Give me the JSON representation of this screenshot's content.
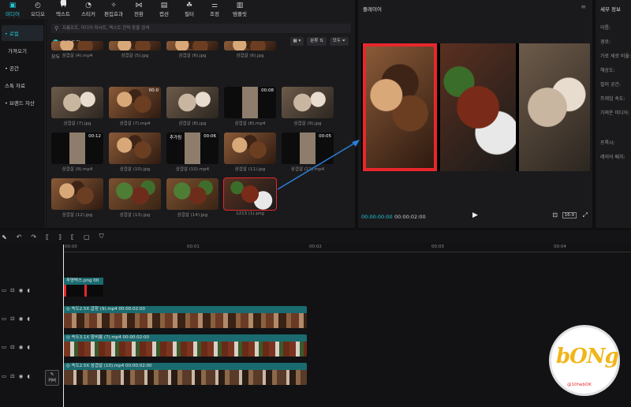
{
  "toolbar": {
    "items": [
      {
        "label": "미디어",
        "icon": "media-icon",
        "active": true
      },
      {
        "label": "오디오",
        "icon": "audio-icon"
      },
      {
        "label": "텍스트",
        "icon": "text-icon"
      },
      {
        "label": "스티커",
        "icon": "sticker-icon"
      },
      {
        "label": "편집효과",
        "icon": "effects-icon"
      },
      {
        "label": "전환",
        "icon": "transition-icon"
      },
      {
        "label": "캡션",
        "icon": "caption-icon"
      },
      {
        "label": "필터",
        "icon": "filter-icon"
      },
      {
        "label": "조정",
        "icon": "adjust-icon"
      },
      {
        "label": "템플릿",
        "icon": "template-icon"
      }
    ]
  },
  "leftnav": {
    "items": [
      {
        "label": "• 로컬",
        "active": true
      },
      {
        "label": "가져오기",
        "sub": true
      },
      {
        "label": "• 공간"
      },
      {
        "label": "스톡 자료"
      },
      {
        "label": "• 브랜드 자산"
      }
    ]
  },
  "media": {
    "search_placeholder": "프롬프트, 미디어 파서트, 텍스트 전략 등을 검색",
    "import_label": "가져오기",
    "sort_label": "분류",
    "all_label": "모두",
    "filter_label": "모두",
    "section_label": "모두",
    "items": [
      {
        "caption": "삼겹살 (4).mp4",
        "style": "meat"
      },
      {
        "caption": "삼겹살 (5).jpg",
        "style": "meat"
      },
      {
        "caption": "삼겹살 (6).jpg",
        "style": "meat"
      },
      {
        "caption": "삼겹살 (6).jpg",
        "style": "meat"
      },
      {
        "caption": "삼겹살 (7).jpg",
        "style": "meat2"
      },
      {
        "caption": "삼겹살 (7).mp4",
        "style": "meat",
        "duration": "00:0"
      },
      {
        "caption": "삼겹살 (8).jpg",
        "style": "meat2"
      },
      {
        "caption": "삼겹살 (8).mp4",
        "style": "dark",
        "duration": "00:08"
      },
      {
        "caption": "삼겹살 (9).jpg",
        "style": "meat2"
      },
      {
        "caption": "삼겹살 (9).mp4",
        "style": "dark",
        "duration": "00:12"
      },
      {
        "caption": "삼겹살 (10).jpg",
        "style": "meat"
      },
      {
        "caption": "삼겹살 (10).mp4",
        "style": "dark",
        "duration": "00:06",
        "badge": "추가됨"
      },
      {
        "caption": "삼겹살 (11).jpg",
        "style": "meat"
      },
      {
        "caption": "삼겹살 (11).mp4",
        "style": "dark",
        "duration": "00:05"
      },
      {
        "caption": "삼겹살 (12).jpg",
        "style": "meat"
      },
      {
        "caption": "삼겹살 (13).jpg",
        "style": "greens"
      },
      {
        "caption": "삼겹살 (14).jpg",
        "style": "greens"
      },
      {
        "caption": "1213 (1).png",
        "style": "meat3"
      }
    ]
  },
  "player": {
    "title": "플레이어",
    "time_current": "00:00:00:00",
    "time_total": "00:00:02:00",
    "ratio": "16:9"
  },
  "detail": {
    "title": "세부 정보",
    "labels": [
      "이름:",
      "경로:",
      "가로 세로 비율:",
      "해상도:",
      "컬러 공간:",
      "프레임 속도:",
      "가져온 미디어:",
      "프록시:",
      "레이어 배치:"
    ]
  },
  "timeline": {
    "ruler": [
      "00:00",
      "00:01",
      "00:02",
      "00:03",
      "00:04"
    ],
    "image_clip": "투명박스.png  00",
    "video_clips": [
      {
        "label": "◎ 속도2.5X  곱창 (9).mp4  00:00:02:00",
        "style": "fr-meat"
      },
      {
        "label": "◎ 속도3.1X  항비름 (7).mp4  00:00:02:00",
        "style": "fr-food"
      },
      {
        "label": "◎ 속도2.5X  삼겹살 (10).mp4  00:00:02:00",
        "style": "fr-mix"
      }
    ],
    "cover_label": "커버"
  },
  "watermark": {
    "text": "bONg",
    "sub": "@10hebOK"
  },
  "colors": {
    "accent": "#22c8d8",
    "highlight": "#e7272d",
    "clip_header": "#1a6b6f",
    "arrow": "#2a7fd8"
  }
}
